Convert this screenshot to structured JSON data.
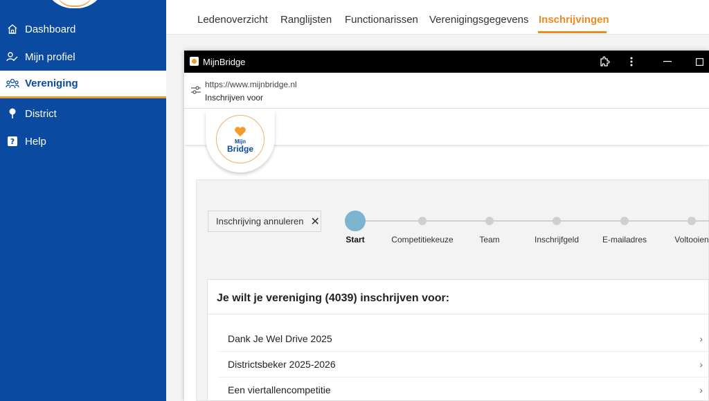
{
  "sidebar": {
    "items": [
      {
        "label": "Dashboard",
        "icon": "home-icon"
      },
      {
        "label": "Mijn profiel",
        "icon": "user-edit-icon"
      },
      {
        "label": "Vereniging",
        "icon": "group-icon",
        "active": true
      },
      {
        "label": "District",
        "icon": "pin-icon"
      },
      {
        "label": "Help",
        "icon": "help-icon"
      }
    ]
  },
  "tabs": [
    {
      "label": "Ledenoverzicht"
    },
    {
      "label": "Ranglijsten"
    },
    {
      "label": "Functionarissen"
    },
    {
      "label": "Verenigingsgegevens"
    },
    {
      "label": "Inschrijvingen",
      "active": true
    }
  ],
  "window": {
    "title": "MijnBridge",
    "url": "https://www.mijnbridge.nl",
    "page_title": "Inschrijven voor"
  },
  "logo": {
    "line1": "Mijn",
    "line2": "Bridge"
  },
  "wizard": {
    "cancel_label": "Inschrijving annuleren",
    "steps": [
      "Start",
      "Competitiekeuze",
      "Team",
      "Inschrijfgeld",
      "E-mailadres",
      "Voltooien"
    ],
    "active_step": 0
  },
  "list": {
    "title": "Je wilt je vereniging (4039) inschrijven voor:",
    "items": [
      "Dank Je Wel Drive 2025",
      "Districtsbeker 2025-2026",
      "Een viertallencompetitie"
    ]
  },
  "colors": {
    "sidebar": "#0a4aa0",
    "accent": "#f08a1c",
    "step_active": "#7ab4cf"
  }
}
